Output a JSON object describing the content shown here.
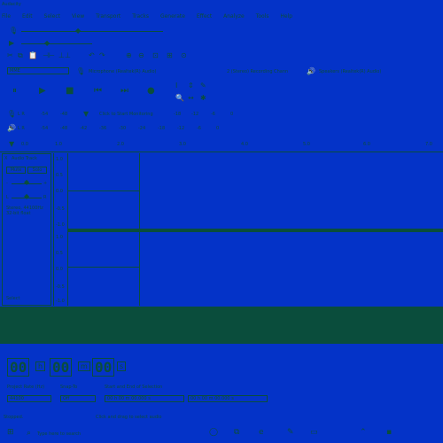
{
  "window": {
    "title": "Audacity"
  },
  "menu": [
    "File",
    "Edit",
    "Select",
    "View",
    "Transport",
    "Tracks",
    "Generate",
    "Effect",
    "Analyze",
    "Tools",
    "Help"
  ],
  "transport": {
    "pause": "⏸",
    "play": "▶",
    "stop": "■",
    "skip_start": "⏮",
    "skip_end": "⏭",
    "record": "●"
  },
  "meters": {
    "record_scale": [
      "-54",
      "-48",
      "-42",
      "-36",
      "-30",
      "-24",
      "-18",
      "-12",
      "-6",
      "0"
    ],
    "play_scale": [
      "-54",
      "-48",
      "-42",
      "-36",
      "-30",
      "-24",
      "-18",
      "-12",
      "-6",
      "0"
    ],
    "record_hint": "Click to Start Monitoring"
  },
  "device": {
    "host": "MME",
    "mic": "Microphone (Realtek(R) Audio)",
    "channels": "2 (Stereo) Recording Chann",
    "speaker": "Speakers (Realtek(R) Audio)"
  },
  "ruler": [
    "0.0",
    "1.0",
    "2.0",
    "3.0",
    "4.0",
    "5.0",
    "6.0",
    "7.0"
  ],
  "track": {
    "name": "Audio Track",
    "close": "X",
    "mute": "Mute",
    "solo": "Solo",
    "gain_minus": "-",
    "gain_plus": "+",
    "pan_l": "L",
    "pan_r": "R",
    "info": "Stereo, 44100Hz\n32-bit float",
    "select": "Select",
    "scale": [
      "1.0",
      "0.5",
      "0.0",
      "-0.5",
      "-1.0",
      "1.0",
      "0.5",
      "0.0",
      "-0.5",
      "-1.0"
    ]
  },
  "time": {
    "h": "00",
    "h_unit": "h",
    "m": "00",
    "m_unit": "m",
    "s": "00",
    "s_unit": "s"
  },
  "selection": {
    "rate_label": "Project Rate (Hz)",
    "snap_label": "Snap-To",
    "rate_value": "44100",
    "snap_value": "Off",
    "sel_label": "Start and End of Selection",
    "sel_start": "00 h 00 m 00.000 s",
    "sel_end": "00 h 00 m 00.000 s"
  },
  "status": {
    "state": "Stopped.",
    "hint": "Click and drag to select audio"
  },
  "taskbar": {
    "search_placeholder": "Type here to search"
  }
}
